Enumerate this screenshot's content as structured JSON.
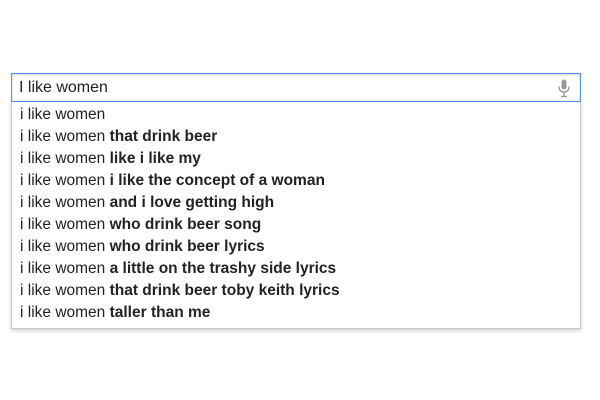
{
  "search": {
    "value": "I like women",
    "mic_icon": "microphone-icon"
  },
  "suggestions": [
    {
      "prefix": "i like women",
      "completion": ""
    },
    {
      "prefix": "i like women ",
      "completion": "that drink beer"
    },
    {
      "prefix": "i like women ",
      "completion": "like i like my"
    },
    {
      "prefix": "i like women ",
      "completion": "i like the concept of a woman"
    },
    {
      "prefix": "i like women ",
      "completion": "and i love getting high"
    },
    {
      "prefix": "i like women ",
      "completion": "who drink beer song"
    },
    {
      "prefix": "i like women ",
      "completion": "who drink beer lyrics"
    },
    {
      "prefix": "i like women ",
      "completion": "a little on the trashy side lyrics"
    },
    {
      "prefix": "i like women ",
      "completion": "that drink beer toby keith lyrics"
    },
    {
      "prefix": "i like women ",
      "completion": "taller than me"
    }
  ],
  "colors": {
    "focus_border": "#4d90fe",
    "dropdown_border": "#c6c6c6",
    "text": "#222222",
    "mic_icon": "#999999"
  }
}
